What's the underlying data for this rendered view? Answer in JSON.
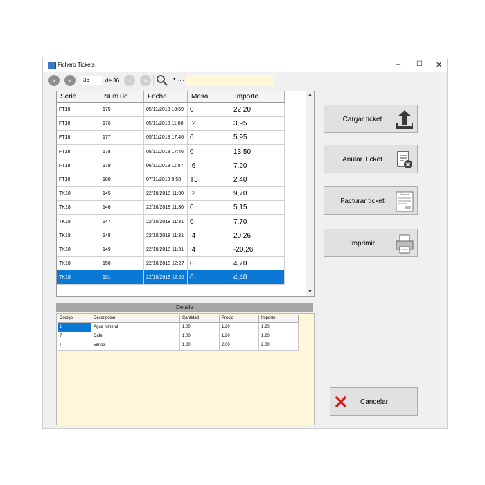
{
  "window": {
    "title": "Fichero Tickets",
    "minimize": "–",
    "maximize": "☐",
    "close": "✕"
  },
  "toolbar": {
    "first": "«",
    "prev": "‹",
    "next": "›",
    "last": "»",
    "position": "36",
    "of_label": "de 36",
    "search_caret": "▾",
    "search_more": "...."
  },
  "grid": {
    "columns": [
      "Serie",
      "NumTic",
      "Fecha",
      "Mesa",
      "Importe"
    ],
    "rows": [
      [
        "FT18",
        "175",
        "05/11/2018 10:59",
        "0",
        "22,20"
      ],
      [
        "FT18",
        "176",
        "05/11/2018 11:00",
        "I2",
        "3,95"
      ],
      [
        "FT18",
        "177",
        "05/11/2018 17:46",
        "0",
        "5,95"
      ],
      [
        "FT18",
        "178",
        "05/11/2018 17:46",
        "0",
        "13,50"
      ],
      [
        "FT18",
        "179",
        "06/11/2018 11:07",
        "I6",
        "7,20"
      ],
      [
        "FT18",
        "180",
        "07/11/2018 9:58",
        "T3",
        "2,40"
      ],
      [
        "TK18",
        "145",
        "22/10/2018 11:30",
        "I2",
        "9,70"
      ],
      [
        "TK18",
        "146",
        "22/10/2018 11:30",
        "0",
        "5,15"
      ],
      [
        "TK18",
        "147",
        "22/10/2018 11:31",
        "0",
        "7,70"
      ],
      [
        "TK18",
        "148",
        "22/10/2018 11:31",
        "I4",
        "20,26"
      ],
      [
        "TK18",
        "149",
        "22/10/2018 11:31",
        "I4",
        "-20,26"
      ],
      [
        "TK18",
        "150",
        "22/10/2018 12:27",
        "0",
        "4,70"
      ],
      [
        "TK18",
        "151",
        "22/10/2018 12:50",
        "0",
        "4,40"
      ]
    ],
    "scroll_up": "▲",
    "scroll_down": "▼"
  },
  "detail": {
    "title": "Detalle",
    "columns": [
      "Codigo",
      "Descripción",
      "Cantidad",
      "Precio",
      "Importe"
    ],
    "rows": [
      [
        "1",
        "Agua mineral",
        "1,00",
        "1,20",
        "1,20"
      ],
      [
        "7",
        "Cafe",
        "1,00",
        "1,20",
        "1,20"
      ],
      [
        "+",
        "Varios",
        "1,00",
        "2,00",
        "2,00"
      ]
    ]
  },
  "actions": {
    "load": "Cargar ticket",
    "cancel_ticket": "Anular Ticket",
    "invoice": "Facturar ticket",
    "print": "Imprimir",
    "invoice_icon_text": "Factura",
    "close": "Cancelar"
  },
  "colors": {
    "selection": "#0a78d4",
    "detail_bg": "#fff7d7",
    "cancel_x": "#d81e1e",
    "upload_icon": "#3a3a3a"
  },
  "icons": [
    "first-page-icon",
    "previous-page-icon",
    "next-page-icon",
    "last-page-icon",
    "search-icon",
    "upload-icon",
    "cancel-document-icon",
    "invoice-icon",
    "printer-icon",
    "cancel-x-icon"
  ]
}
